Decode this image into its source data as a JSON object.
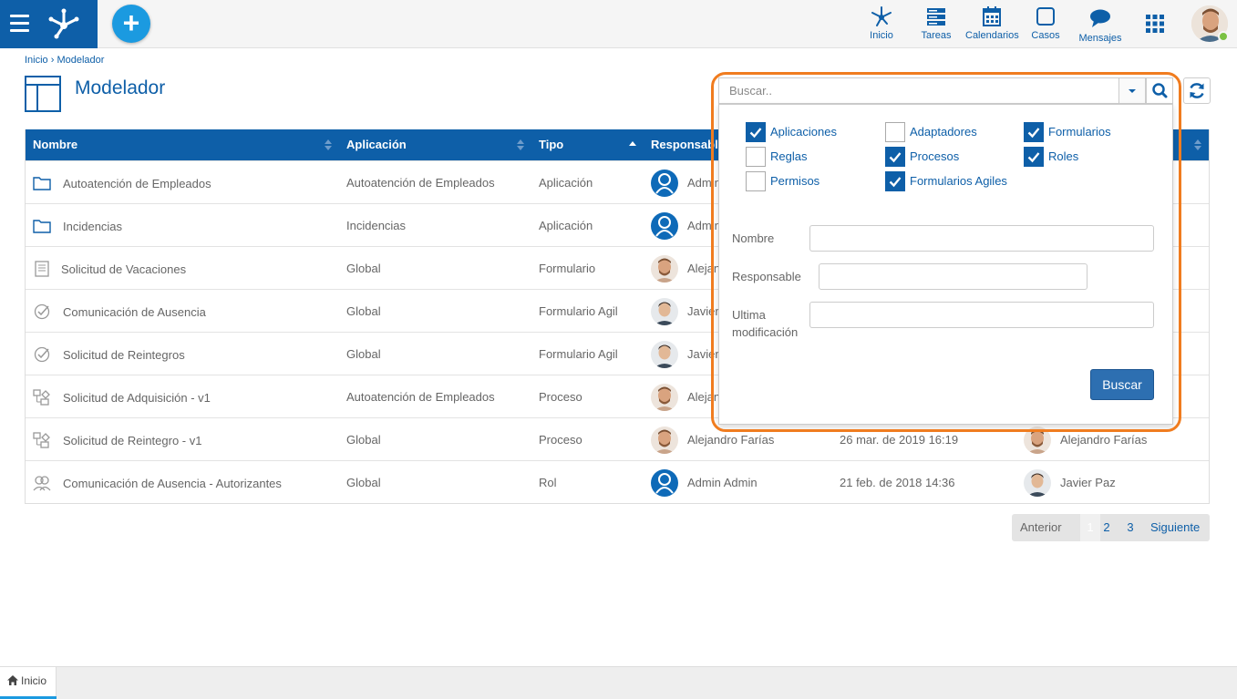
{
  "topbar": {
    "nav": [
      {
        "label": "Inicio",
        "icon": "network-icon"
      },
      {
        "label": "Tareas",
        "icon": "tasks-icon"
      },
      {
        "label": "Calendarios",
        "icon": "calendar-icon"
      },
      {
        "label": "Casos",
        "icon": "cases-icon"
      },
      {
        "label": "Mensajes",
        "icon": "chat-icon"
      }
    ]
  },
  "breadcrumb": "Inicio › Modelador",
  "page_title": "Modelador",
  "table": {
    "headers": [
      "Nombre",
      "Aplicación",
      "Tipo",
      "Responsable"
    ],
    "rows": [
      {
        "name": "Autoatención de Empleados",
        "app": "Autoatención de Empleados",
        "type": "Aplicación",
        "resp": "Admin Admin",
        "date": "",
        "mod": "",
        "icon": "folder-icon",
        "avatar": "admin"
      },
      {
        "name": "Incidencias",
        "app": "Incidencias",
        "type": "Aplicación",
        "resp": "Admin Admin",
        "date": "",
        "mod": "",
        "icon": "folder-icon",
        "avatar": "admin"
      },
      {
        "name": "Solicitud de Vacaciones",
        "app": "Global",
        "type": "Formulario",
        "resp": "Alejandro Farías",
        "date": "",
        "mod": "",
        "icon": "form-icon",
        "avatar": "alejandro"
      },
      {
        "name": "Comunicación de Ausencia",
        "app": "Global",
        "type": "Formulario Agil",
        "resp": "Javier Paz",
        "date": "",
        "mod": "",
        "icon": "agile-form-icon",
        "avatar": "javier"
      },
      {
        "name": "Solicitud de Reintegros",
        "app": "Global",
        "type": "Formulario Agil",
        "resp": "Javier Paz",
        "date": "",
        "mod": "",
        "icon": "agile-form-icon",
        "avatar": "javier"
      },
      {
        "name": "Solicitud de Adquisición - v1",
        "app": "Autoatención de Empleados",
        "type": "Proceso",
        "resp": "Alejandro Farías",
        "date": "",
        "mod": "",
        "icon": "process-icon",
        "avatar": "alejandro"
      },
      {
        "name": "Solicitud de Reintegro - v1",
        "app": "Global",
        "type": "Proceso",
        "resp": "Alejandro Farías",
        "date": "26 mar. de 2019 16:19",
        "mod": "Alejandro Farías",
        "icon": "process-icon",
        "avatar": "alejandro",
        "mod_avatar": "alejandro"
      },
      {
        "name": "Comunicación de Ausencia - Autorizantes",
        "app": "Global",
        "type": "Rol",
        "resp": "Admin Admin",
        "date": "21 feb. de 2018 14:36",
        "mod": "Javier Paz",
        "icon": "role-icon",
        "avatar": "admin",
        "mod_avatar": "javier"
      }
    ]
  },
  "pagination": {
    "prev": "Anterior",
    "pages": [
      "1",
      "2",
      "3"
    ],
    "next": "Siguiente",
    "current": "1"
  },
  "search": {
    "placeholder": "Buscar..",
    "checkboxes": [
      {
        "label": "Aplicaciones",
        "checked": true
      },
      {
        "label": "Adaptadores",
        "checked": false
      },
      {
        "label": "Formularios",
        "checked": true
      },
      {
        "label": "Reglas",
        "checked": false
      },
      {
        "label": "Procesos",
        "checked": true
      },
      {
        "label": "Roles",
        "checked": true
      },
      {
        "label": "Permisos",
        "checked": false
      },
      {
        "label": "Formularios Agiles",
        "checked": true
      }
    ],
    "fields": {
      "nombre": "Nombre",
      "responsable": "Responsable",
      "ultima_mod": "Ultima modificación"
    },
    "submit": "Buscar"
  },
  "footer": {
    "tab": "Inicio"
  },
  "colors": {
    "primary": "#0e5fa8",
    "accent": "#1b9ae0",
    "highlight": "#f07c1f",
    "online": "#7ac142"
  }
}
